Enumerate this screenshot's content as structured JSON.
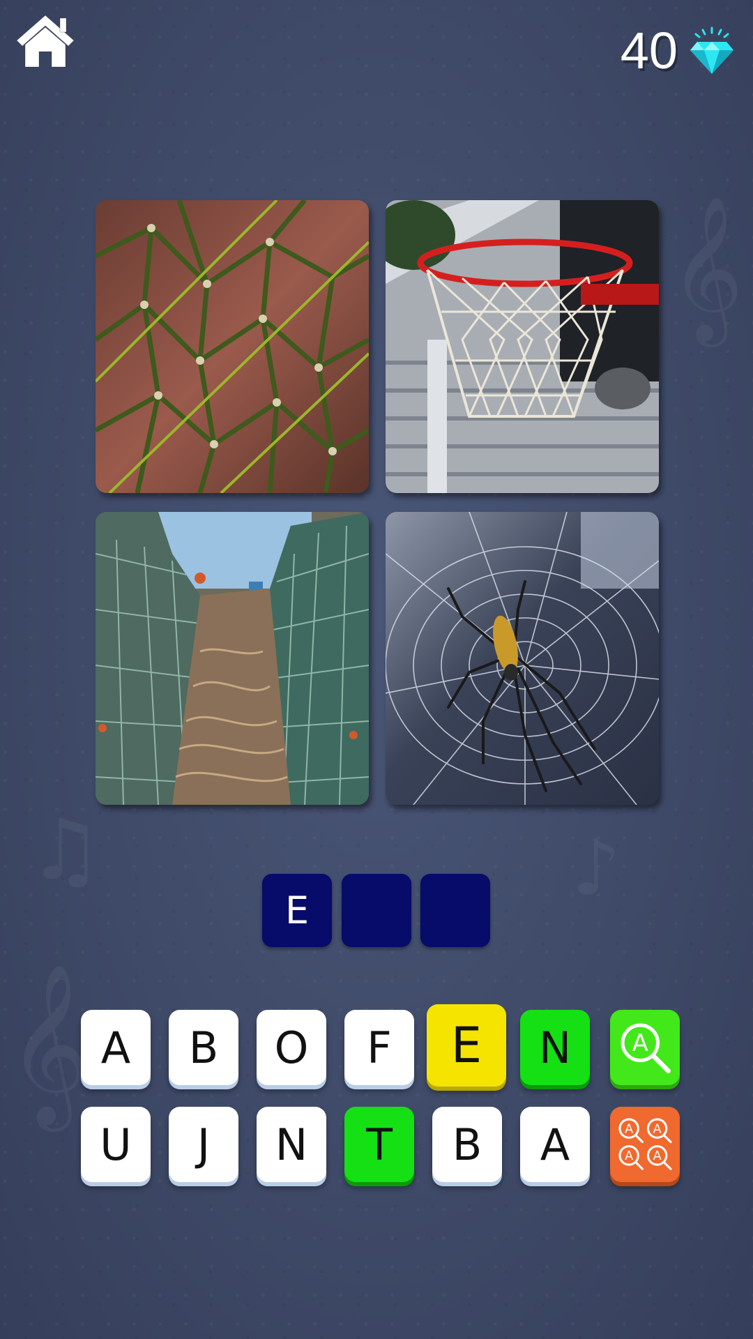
{
  "header": {
    "home_icon": "home-icon",
    "coin_count": "40",
    "currency_icon": "diamond-icon"
  },
  "pictures": [
    {
      "name": "green-rope-net",
      "icon": "rope-net-image"
    },
    {
      "name": "basketball-hoop",
      "icon": "basketball-hoop-image"
    },
    {
      "name": "fishing-nets",
      "icon": "fishing-nets-image"
    },
    {
      "name": "spider-web",
      "icon": "spider-web-image"
    }
  ],
  "answer": {
    "slots": [
      "E",
      "",
      ""
    ]
  },
  "keyboard": {
    "row1": [
      "A",
      "B",
      "O",
      "F",
      "E",
      "N"
    ],
    "row2": [
      "U",
      "J",
      "N",
      "T",
      "B",
      "A"
    ]
  },
  "powerups": {
    "reveal_letter_icon": "magnify-letter-icon",
    "reveal_all_icon": "magnify-multi-letter-icon"
  },
  "colors": {
    "background": "#3f4a68",
    "slot": "#070b6a",
    "key": "#ffffff",
    "highlight_yellow": "#f5e400",
    "highlight_green": "#14e014",
    "reveal_green": "#43e81a",
    "reveal_orange": "#f0692f",
    "gem": "#2ee6f2"
  }
}
